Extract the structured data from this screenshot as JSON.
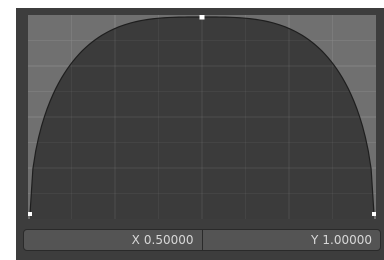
{
  "curve_editor": {
    "background_color": "#707070",
    "fill_color": "#3b3b3b",
    "grid_color": "#848484",
    "curve_color": "#1e1e1e",
    "point_color": "#ffffff",
    "control_points": [
      {
        "x": 0.0,
        "y": 0.0
      },
      {
        "x": 0.5,
        "y": 1.0
      },
      {
        "x": 1.0,
        "y": 0.0
      }
    ],
    "selected_point_index": 1
  },
  "coordinates": {
    "x_label": "X",
    "x_value": "0.50000",
    "y_label": "Y",
    "y_value": "1.00000"
  }
}
